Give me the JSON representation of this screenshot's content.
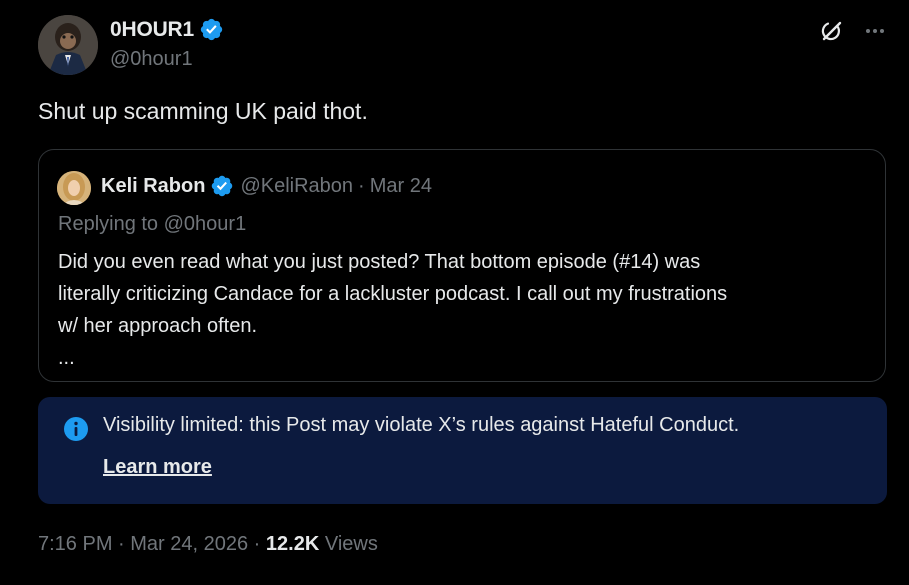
{
  "post": {
    "author": {
      "display_name": "0HOUR1",
      "handle": "@0hour1",
      "verified": true
    },
    "text": "Shut up scamming UK paid thot.",
    "quoted_post": {
      "author_name": "Keli Rabon",
      "author_handle": "@KeliRabon",
      "separator": "·",
      "date": "Mar 24",
      "replying_prefix": "Replying to ",
      "replying_handle": "@0hour1",
      "body_lines": [
        "Did you even read what you just posted? That bottom episode (#14) was",
        "literally criticizing Candace for a lackluster podcast. I call out my frustrations",
        "w/ her approach often.",
        "..."
      ]
    },
    "notice": {
      "icon": "info-icon",
      "text": "Visibility limited: this Post may violate X’s rules against Hateful Conduct.",
      "link_label": "Learn more"
    },
    "meta": {
      "time": "7:16 PM",
      "dot1": " · ",
      "date": "Mar 24, 2026",
      "dot2": " · ",
      "views_count": "12.2K",
      "views_label": " Views"
    }
  },
  "icons": {
    "verified": "verified-badge-icon",
    "grok": "grok-icon",
    "more": "more-options-icon"
  },
  "colors": {
    "background": "#000000",
    "text_primary": "#e7e9ea",
    "text_secondary": "#71767b",
    "border": "#2f3336",
    "verified_blue": "#1d9bf0",
    "notice_bg": "#0c1a3e"
  }
}
